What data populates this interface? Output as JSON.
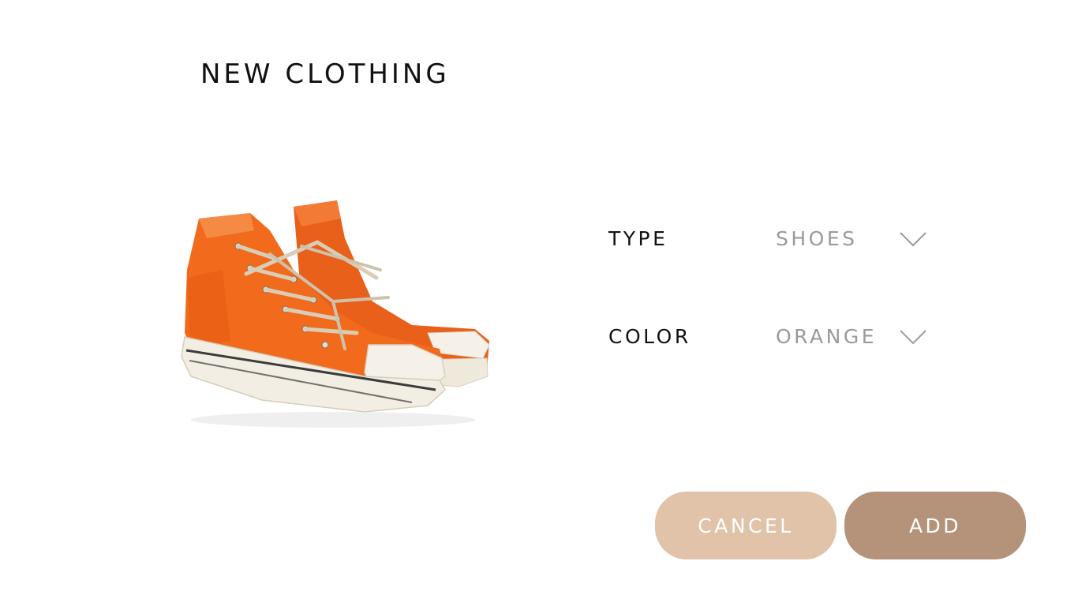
{
  "header": {
    "title": "NEW CLOTHING"
  },
  "product": {
    "image_icon": "orange-high-top-sneakers",
    "colors": {
      "canvas": "#f26a1b",
      "canvas_shadow": "#c8500f",
      "sole": "#f3eee3",
      "lace": "#d9cdb8"
    }
  },
  "form": {
    "type": {
      "label": "TYPE",
      "value": "SHOES",
      "icon": "chevron-down-icon"
    },
    "color": {
      "label": "COLOR",
      "value": "ORANGE",
      "icon": "chevron-down-icon"
    }
  },
  "actions": {
    "cancel_label": "CANCEL",
    "add_label": "ADD",
    "colors": {
      "cancel": "#e0c3a9",
      "add": "#b5937a"
    }
  }
}
